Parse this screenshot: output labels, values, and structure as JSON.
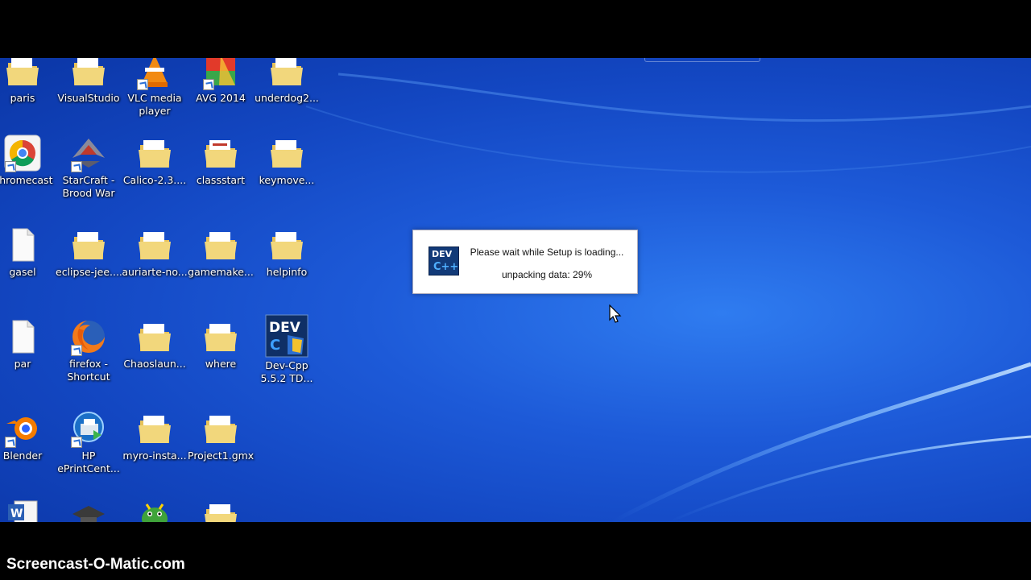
{
  "watermark": "Screencast-O-Matic.com",
  "colors": {
    "desktop": "#1d5ad8",
    "folder": "#e9c65a",
    "dialog_bg": "#ffffff"
  },
  "desktop_icons": [
    {
      "label": "paris",
      "icon": "folder-icon"
    },
    {
      "label": "VisualStudio",
      "icon": "folder-icon"
    },
    {
      "label": "VLC media player",
      "icon": "vlc-icon"
    },
    {
      "label": "AVG 2014",
      "icon": "avg-icon"
    },
    {
      "label": "underdog2...",
      "icon": "folder-icon"
    },
    {
      "label": "Chromecast",
      "icon": "chrome-icon"
    },
    {
      "label": "StarCraft - Brood War",
      "icon": "starcraft-icon"
    },
    {
      "label": "Calico-2.3....",
      "icon": "folder-icon"
    },
    {
      "label": "classstart",
      "icon": "folder-icon"
    },
    {
      "label": "keymove...",
      "icon": "folder-icon"
    },
    {
      "label": "gasel",
      "icon": "file-icon"
    },
    {
      "label": "eclipse-jee....",
      "icon": "folder-icon"
    },
    {
      "label": "auriarte-no...",
      "icon": "folder-icon"
    },
    {
      "label": "gamemake...",
      "icon": "folder-icon"
    },
    {
      "label": "helpinfo",
      "icon": "folder-icon"
    },
    {
      "label": "par",
      "icon": "file-icon"
    },
    {
      "label": "firefox - Shortcut",
      "icon": "firefox-icon"
    },
    {
      "label": "Chaoslaun...",
      "icon": "folder-icon"
    },
    {
      "label": "where",
      "icon": "folder-icon"
    },
    {
      "label": "Dev-Cpp 5.5.2 TD...",
      "icon": "devcpp-icon"
    },
    {
      "label": "Blender",
      "icon": "blender-icon"
    },
    {
      "label": "HP ePrintCent...",
      "icon": "hp-eprint-icon"
    },
    {
      "label": "myro-insta...",
      "icon": "folder-icon"
    },
    {
      "label": "Project1.gmx",
      "icon": "folder-icon"
    }
  ],
  "dialog": {
    "message": "Please wait while Setup is loading...",
    "progress_text": "unpacking data: 29%",
    "progress": 0.29,
    "app_icon_text": "DEV",
    "app_icon_sub": "C++"
  },
  "devcpp_icon_text": "DEV"
}
